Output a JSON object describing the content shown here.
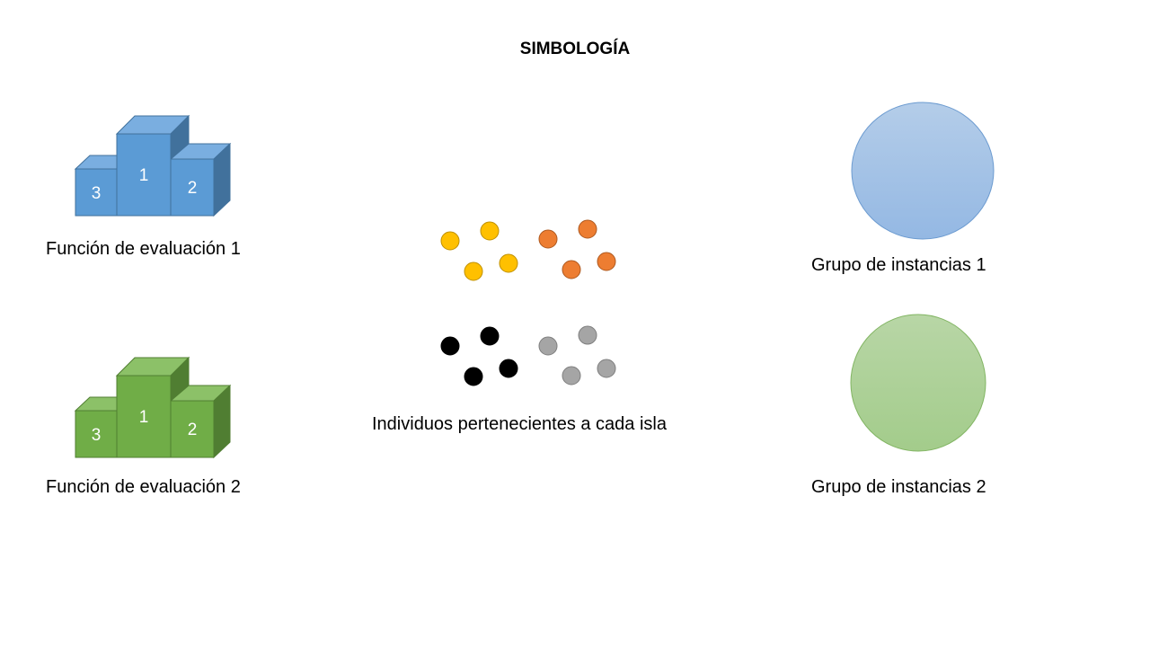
{
  "title": "SIMBOLOGÍA",
  "podiums": [
    {
      "label": "Función de evaluación 1",
      "ranks": [
        "1",
        "2",
        "3"
      ],
      "colors": {
        "front": "#5b9bd5",
        "top": "#7aaee0",
        "side": "#41719c",
        "edge": "#41719c"
      }
    },
    {
      "label": "Función de evaluación 2",
      "ranks": [
        "1",
        "2",
        "3"
      ],
      "colors": {
        "front": "#70ad47",
        "top": "#8cc168",
        "side": "#507e32",
        "edge": "#507e32"
      }
    }
  ],
  "individuals": {
    "label": "Individuos pertenecientes a cada isla",
    "groups": [
      {
        "color": "#ffc000",
        "stroke": "#bf9000"
      },
      {
        "color": "#ed7d31",
        "stroke": "#ae5a21"
      },
      {
        "color": "#000000",
        "stroke": "#000000"
      },
      {
        "color": "#a5a5a5",
        "stroke": "#7f7f7f"
      }
    ]
  },
  "instance_groups": [
    {
      "label": "Grupo de instancias 1",
      "color_top": "#b4cde9",
      "color_bottom": "#9dbde6",
      "stroke": "#6c9bd0"
    },
    {
      "label": "Grupo de instancias 2",
      "color_top": "#b6d5a3",
      "color_bottom": "#a7cf90",
      "stroke": "#82b563"
    }
  ]
}
